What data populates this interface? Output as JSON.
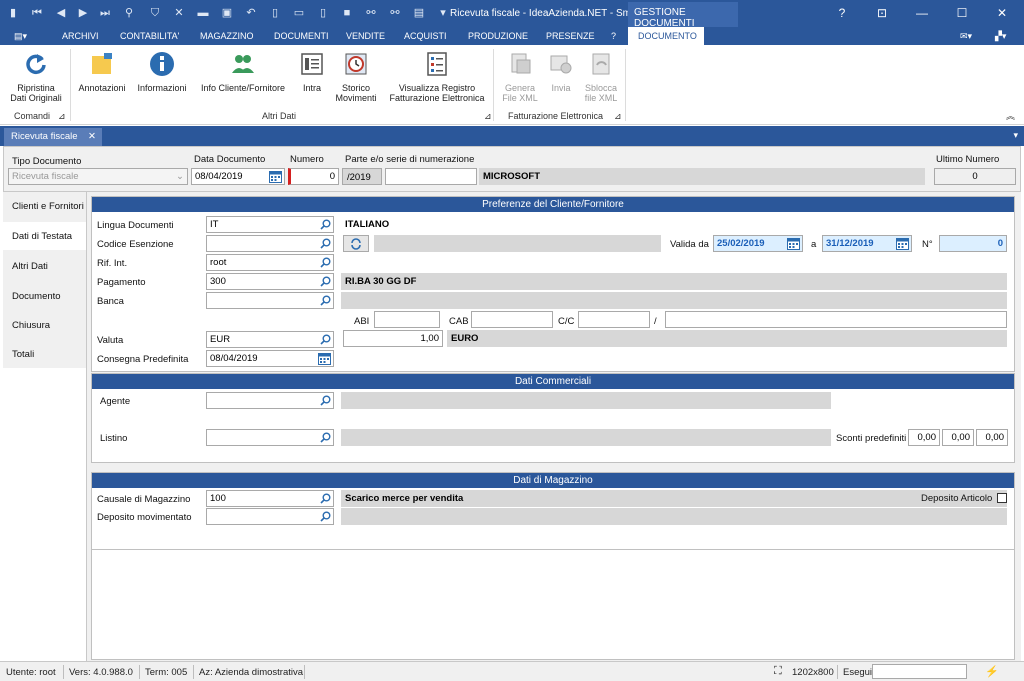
{
  "window": {
    "title": "Ricevuta fiscale - IdeaAzienda.NET - Sm...",
    "context_tab": "GESTIONE DOCUMENTI",
    "help": "?",
    "min": "—",
    "max": "☐",
    "close": "✕"
  },
  "menu": {
    "items": [
      "ARCHIVI",
      "CONTABILITA'",
      "MAGAZZINO",
      "DOCUMENTI",
      "VENDITE",
      "ACQUISTI",
      "PRODUZIONE",
      "PRESENZE",
      "?"
    ],
    "active": "DOCUMENTO"
  },
  "ribbon": {
    "ripristina": "Ripristina\nDati Originali",
    "annotazioni": "Annotazioni",
    "informazioni": "Informazioni",
    "info_cliente": "Info Cliente/Fornitore",
    "intra": "Intra",
    "storico": "Storico\nMovimenti",
    "visualizza": "Visualizza Registro\nFatturazione Elettronica",
    "genera": "Genera\nFile XML",
    "invia": "Invia",
    "sblocca": "Sblocca\nfile XML",
    "group_comandi": "Comandi",
    "group_altri": "Altri Dati",
    "group_fatt": "Fatturazione Elettronica"
  },
  "doc_tab": {
    "label": "Ricevuta fiscale",
    "close": "✕"
  },
  "header": {
    "tipo_label": "Tipo Documento",
    "tipo_value": "Ricevuta fiscale",
    "data_label": "Data Documento",
    "data_value": "08/04/2019",
    "numero_label": "Numero",
    "numero_value": "0",
    "parte_label": "Parte e/o serie di numerazione",
    "parte_value": "/2019",
    "parte_extra": "",
    "company": "MICROSOFT",
    "ultimo_label": "Ultimo Numero",
    "ultimo_value": "0"
  },
  "nav": [
    "Clienti e Fornitori",
    "Dati di Testata",
    "Altri Dati",
    "Documento",
    "Chiusura",
    "Totali"
  ],
  "pref": {
    "title": "Preferenze del Cliente/Fornitore",
    "lingua_label": "Lingua Documenti",
    "lingua_value": "IT",
    "lingua_desc": "ITALIANO",
    "codice_label": "Codice Esenzione",
    "codice_value": "",
    "valida_da_label": "Valida da",
    "valida_da": "25/02/2019",
    "a_label": "a",
    "a_value": "31/12/2019",
    "n_label": "N°",
    "n_value": "0",
    "rif_label": "Rif. Int.",
    "rif_value": "root",
    "pagamento_label": "Pagamento",
    "pagamento_value": "300",
    "pagamento_desc": "RI.BA 30 GG DF",
    "banca_label": "Banca",
    "banca_value": "",
    "abi_label": "ABI",
    "cab_label": "CAB",
    "cc_label": "C/C",
    "slash": "/",
    "valuta_label": "Valuta",
    "valuta_value": "EUR",
    "cambio_value": "1,00",
    "valuta_desc": "EURO",
    "consegna_label": "Consegna Predefinita",
    "consegna_value": "08/04/2019"
  },
  "comm": {
    "title": "Dati Commerciali",
    "agente_label": "Agente",
    "listino_label": "Listino",
    "sconti_label": "Sconti predefiniti",
    "sconto1": "0,00",
    "sconto2": "0,00",
    "sconto3": "0,00"
  },
  "mag": {
    "title": "Dati di Magazzino",
    "causale_label": "Causale di Magazzino",
    "causale_value": "100",
    "causale_desc": "Scarico merce per vendita",
    "deposito_label": "Deposito movimentato",
    "deposito_articolo_label": "Deposito Articolo"
  },
  "status": {
    "utente": "Utente: root",
    "vers": "Vers: 4.0.988.0",
    "term": "Term: 005",
    "az": "Az: Azienda dimostrativa",
    "res": "1202x800",
    "esegui": "Esegui"
  },
  "colors": {
    "brand": "#2b579a",
    "accent_input": "#dcefff"
  }
}
